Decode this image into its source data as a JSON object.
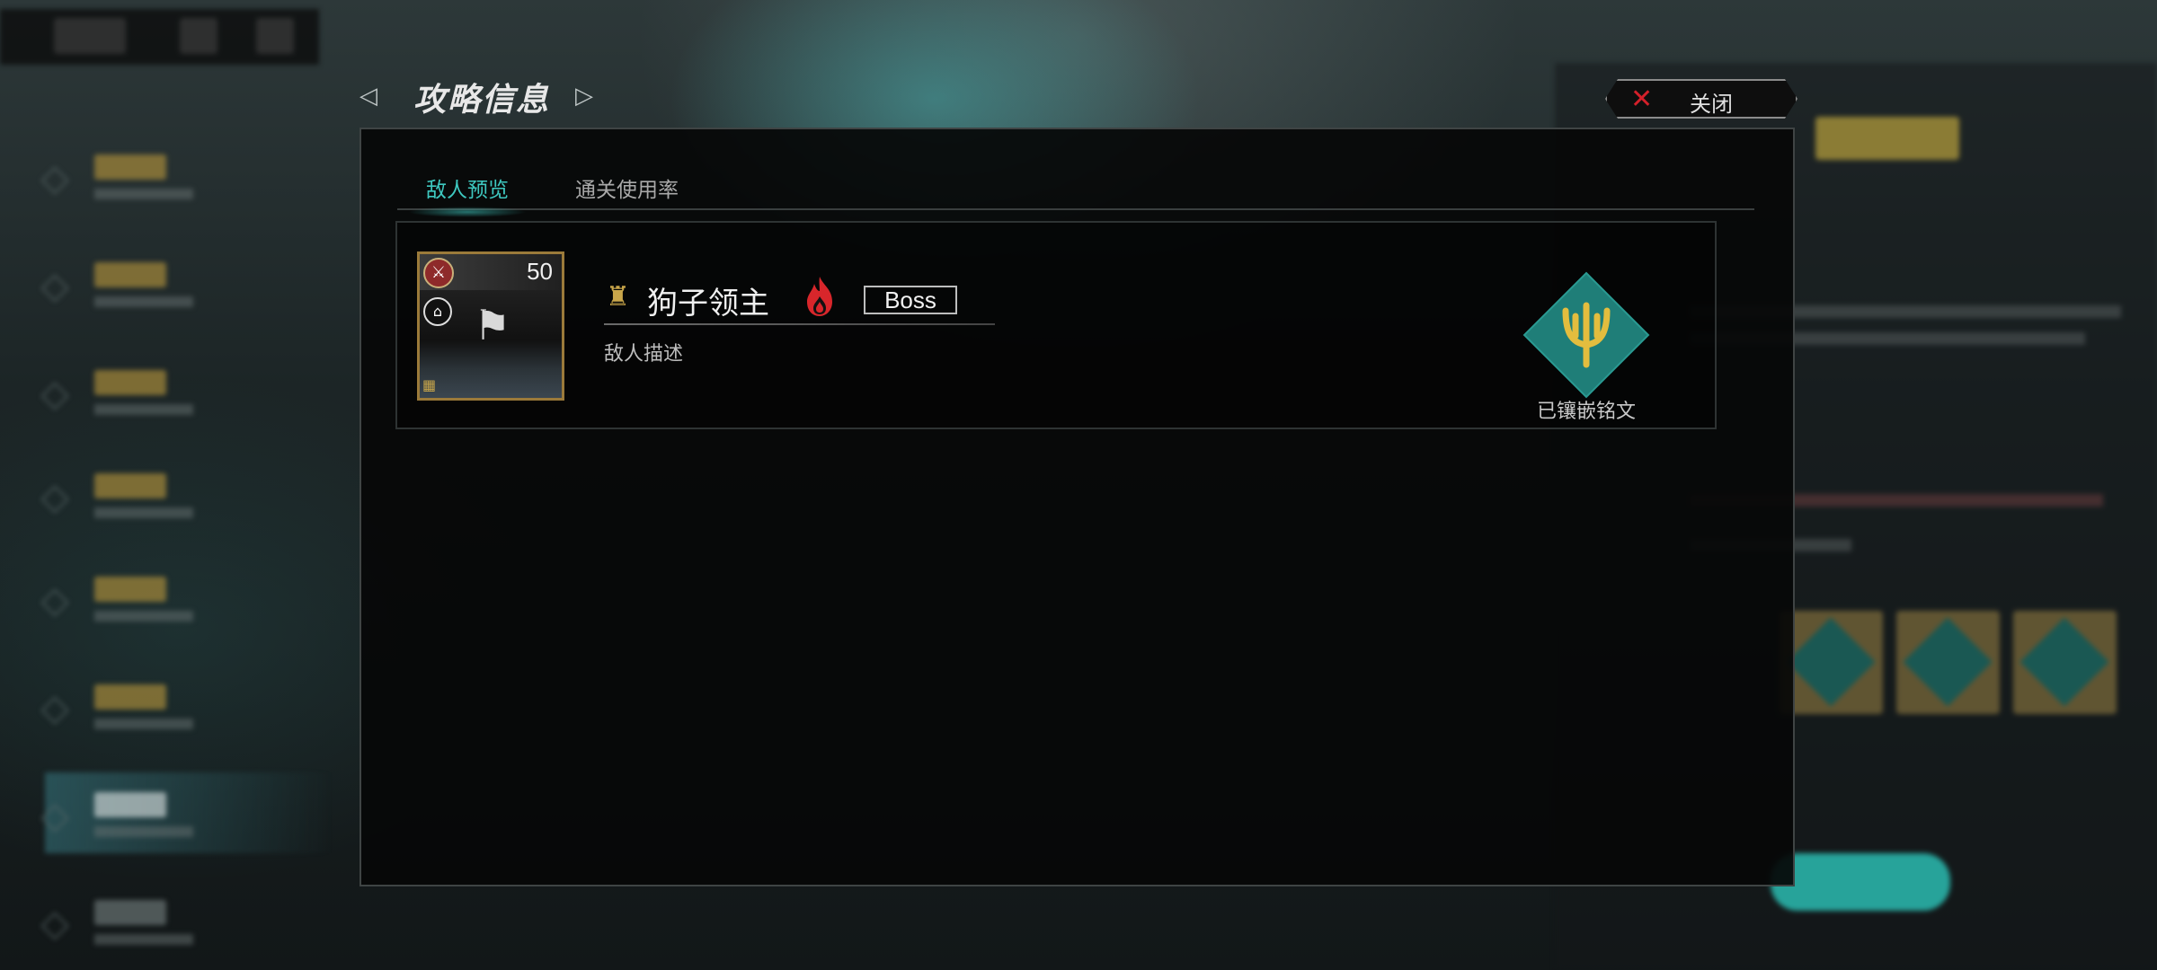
{
  "header": {
    "title": "攻略信息",
    "prev_arrow": "◁",
    "next_arrow": "▷"
  },
  "close_button": {
    "icon": "close-icon",
    "label": "关闭"
  },
  "tabs": [
    {
      "label": "敌人预览",
      "active": true
    },
    {
      "label": "通关使用率",
      "active": false
    }
  ],
  "enemy": {
    "level": "50",
    "name": "狗子领主",
    "tag": "Boss",
    "description": "敌人描述",
    "rune_status": "已镶嵌铭文",
    "icons": {
      "weapon": "sword-icon",
      "home": "home-icon",
      "flag": "flag-icon",
      "rank": "rank-emblem-icon",
      "element": "fire-icon",
      "rune": "trident-rune-icon"
    }
  },
  "colors": {
    "accent_teal": "#3ec8c0",
    "close_red": "#d3202a",
    "gold": "#c9a64a",
    "rune_teal": "#1f7e78",
    "rune_gold": "#e3bd3e"
  }
}
